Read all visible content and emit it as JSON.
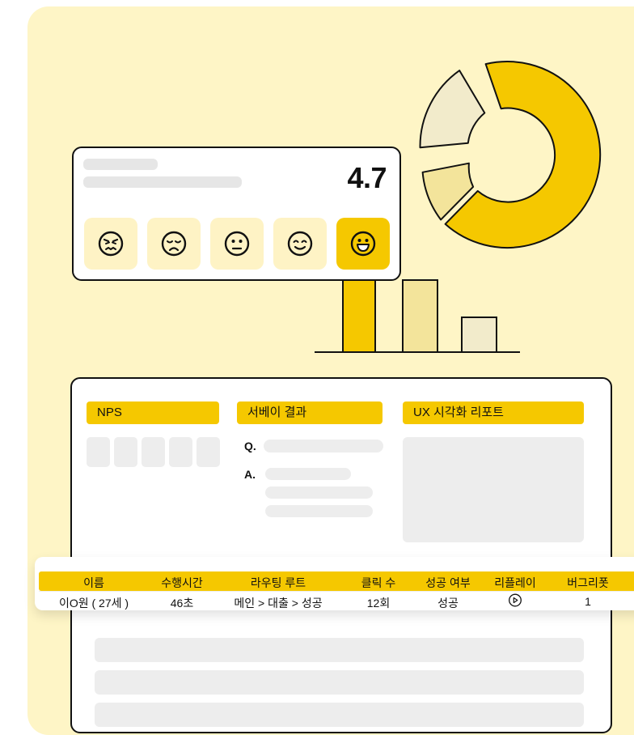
{
  "colors": {
    "accent": "#F5C800",
    "light_accent": "#F3E49B",
    "pale": "#F2EBCB",
    "background": "#FEF5C6"
  },
  "rating_card": {
    "score": "4.7",
    "emojis": [
      {
        "icon": "angry-face-icon",
        "selected": false
      },
      {
        "icon": "sad-face-icon",
        "selected": false
      },
      {
        "icon": "neutral-face-icon",
        "selected": false
      },
      {
        "icon": "smile-face-icon",
        "selected": false
      },
      {
        "icon": "grin-face-icon",
        "selected": true
      }
    ]
  },
  "dashboard": {
    "sections": {
      "nps": "NPS",
      "survey": "서베이 결과",
      "ux_report": "UX 시각화 리포트"
    },
    "qa": {
      "q": "Q.",
      "a": "A."
    }
  },
  "table": {
    "headers": [
      "이름",
      "수행시간",
      "라우팅 루트",
      "클릭 수",
      "성공 여부",
      "리플레이",
      "버그리폿"
    ],
    "rows": [
      {
        "name": "이O원 ( 27세 )",
        "time": "46초",
        "route": "메인 > 대출 > 성공",
        "clicks": "12회",
        "success": "성공",
        "replay_icon": "play-circle-icon",
        "bug_report": "1"
      }
    ]
  }
}
